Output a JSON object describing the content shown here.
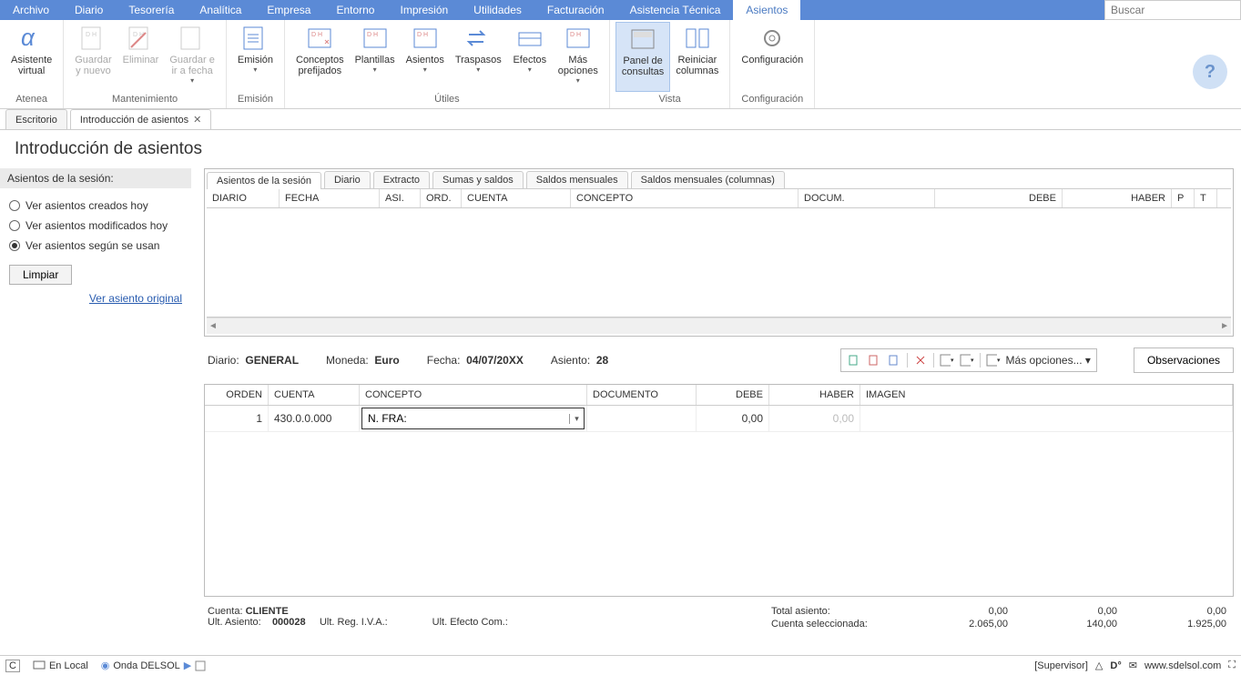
{
  "menu": {
    "items": [
      "Archivo",
      "Diario",
      "Tesorería",
      "Analítica",
      "Empresa",
      "Entorno",
      "Impresión",
      "Utilidades",
      "Facturación",
      "Asistencia Técnica",
      "Asientos"
    ],
    "active_index": 10,
    "search_placeholder": "Buscar"
  },
  "ribbon": {
    "groups": [
      {
        "label": "Atenea",
        "buttons": [
          {
            "label": "Asistente\nvirtual",
            "name": "asistente-virtual-button"
          }
        ]
      },
      {
        "label": "Mantenimiento",
        "buttons": [
          {
            "label": "Guardar\ny nuevo",
            "name": "guardar-nuevo-button",
            "disabled": true
          },
          {
            "label": "Eliminar",
            "name": "eliminar-button",
            "disabled": true
          },
          {
            "label": "Guardar e\nir a fecha",
            "name": "guardar-fecha-button",
            "disabled": true,
            "caret": true
          }
        ]
      },
      {
        "label": "Emisión",
        "buttons": [
          {
            "label": "Emisión",
            "name": "emision-button",
            "caret": true
          }
        ]
      },
      {
        "label": "Útiles",
        "buttons": [
          {
            "label": "Conceptos\nprefijados",
            "name": "conceptos-prefijados-button"
          },
          {
            "label": "Plantillas",
            "name": "plantillas-button",
            "caret": true
          },
          {
            "label": "Asientos",
            "name": "asientos-util-button",
            "caret": true
          },
          {
            "label": "Traspasos",
            "name": "traspasos-button",
            "caret": true
          },
          {
            "label": "Efectos",
            "name": "efectos-button",
            "caret": true
          },
          {
            "label": "Más\nopciones",
            "name": "mas-opciones-button",
            "caret": true
          }
        ]
      },
      {
        "label": "Vista",
        "buttons": [
          {
            "label": "Panel de\nconsultas",
            "name": "panel-consultas-button",
            "active": true
          },
          {
            "label": "Reiniciar\ncolumnas",
            "name": "reiniciar-columnas-button"
          }
        ]
      },
      {
        "label": "Configuración",
        "buttons": [
          {
            "label": "Configuración",
            "name": "configuracion-button"
          }
        ]
      }
    ]
  },
  "doc_tabs": [
    {
      "label": "Escritorio",
      "closable": false
    },
    {
      "label": "Introducción de asientos",
      "closable": true,
      "active": true
    }
  ],
  "page_title": "Introducción de asientos",
  "sidebar": {
    "header": "Asientos de la sesión:",
    "radios": [
      {
        "label": "Ver asientos creados hoy",
        "checked": false
      },
      {
        "label": "Ver asientos modificados hoy",
        "checked": false
      },
      {
        "label": "Ver asientos según se usan",
        "checked": true
      }
    ],
    "clear_btn": "Limpiar",
    "link": "Ver asiento original"
  },
  "inner_tabs": [
    "Asientos de la sesión",
    "Diario",
    "Extracto",
    "Sumas y saldos",
    "Saldos mensuales",
    "Saldos mensuales (columnas)"
  ],
  "grid_headers": [
    "DIARIO",
    "FECHA",
    "ASI.",
    "ORD.",
    "CUENTA",
    "CONCEPTO",
    "DOCUM.",
    "DEBE",
    "HABER",
    "P",
    "T"
  ],
  "info": {
    "diario_label": "Diario:",
    "diario_value": "GENERAL",
    "moneda_label": "Moneda:",
    "moneda_value": "Euro",
    "fecha_label": "Fecha:",
    "fecha_value": "04/07/20XX",
    "asiento_label": "Asiento:",
    "asiento_value": "28",
    "mas_opciones": "Más opciones...",
    "observaciones": "Observaciones"
  },
  "entry_headers": [
    "ORDEN",
    "CUENTA",
    "CONCEPTO",
    "DOCUMENTO",
    "DEBE",
    "HABER",
    "IMAGEN"
  ],
  "entry_row": {
    "orden": "1",
    "cuenta": "430.0.0.000",
    "concepto": "N. FRA: ",
    "debe": "0,00",
    "haber": "0,00"
  },
  "totals": {
    "cuenta_label": "Cuenta:",
    "cuenta_value": "CLIENTE",
    "ult_asiento_label": "Ult. Asiento:",
    "ult_asiento_value": "000028",
    "ult_reg_iva": "Ult. Reg. I.V.A.:",
    "ult_efecto": "Ult. Efecto Com.:",
    "total_asiento_label": "Total asiento:",
    "cuenta_sel_label": "Cuenta seleccionada:",
    "row1": [
      "0,00",
      "0,00",
      "0,00"
    ],
    "row2": [
      "2.065,00",
      "140,00",
      "1.925,00"
    ]
  },
  "statusbar": {
    "c": "C",
    "en_local": "En Local",
    "onda": "Onda DELSOL",
    "supervisor": "[Supervisor]",
    "url": "www.sdelsol.com"
  }
}
